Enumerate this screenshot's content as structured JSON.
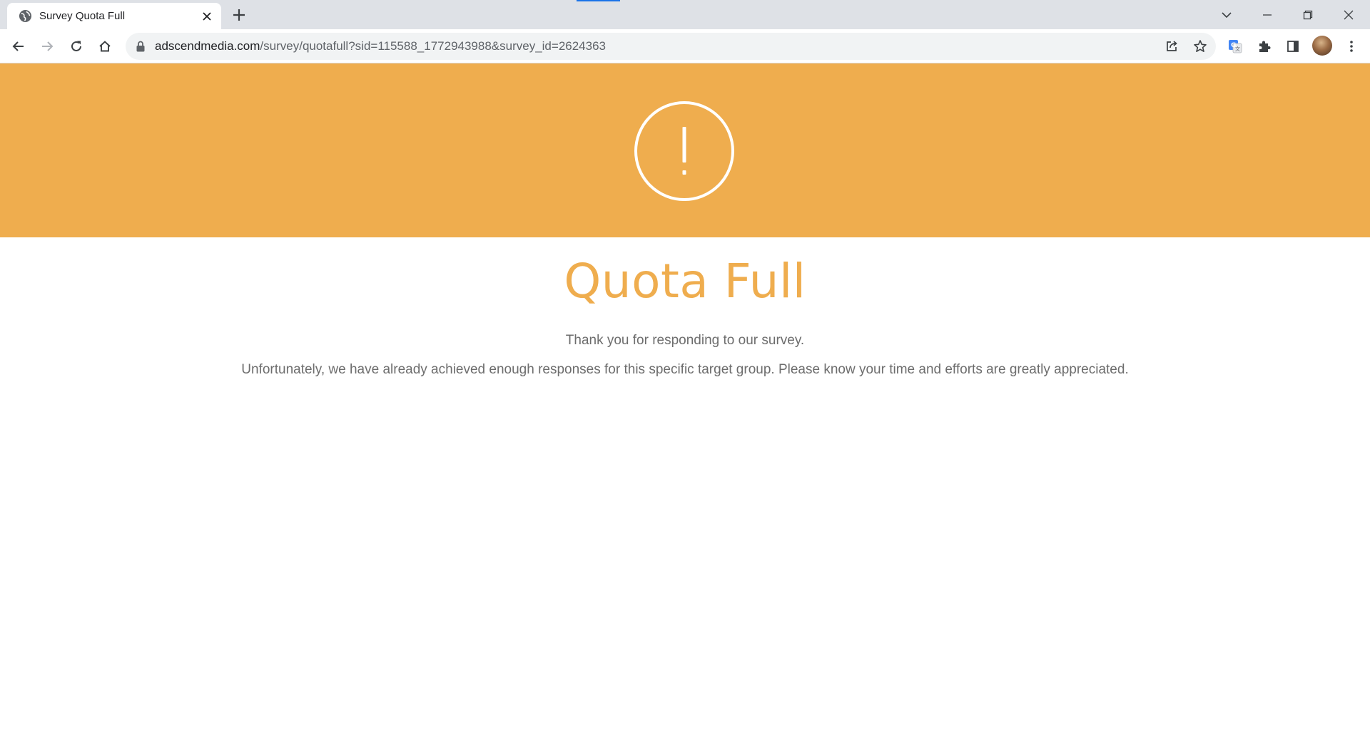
{
  "browser": {
    "tab": {
      "title": "Survey Quota Full"
    },
    "address_bar": {
      "host": "adscendmedia.com",
      "path": "/survey/quotafull?sid=115588_1772943988&survey_id=2624363"
    },
    "icons": {
      "favicon": "globe-icon",
      "close": "close-icon",
      "new_tab": "plus-icon",
      "back": "back-arrow-icon",
      "forward": "forward-arrow-icon",
      "reload": "reload-icon",
      "home": "home-icon",
      "lock": "lock-icon",
      "share": "share-icon",
      "bookmark": "star-icon",
      "translate": "google-translate-icon",
      "extensions": "puzzle-icon",
      "side_panel": "side-panel-icon",
      "menu": "kebab-menu-icon"
    }
  },
  "page": {
    "accent_color": "#efad4e",
    "icon": "exclamation-circle-icon",
    "heading": "Quota Full",
    "message_line_1": "Thank you for responding to our survey.",
    "message_line_2": "Unfortunately, we have already achieved enough responses for this specific target group. Please know your time and efforts are greatly appreciated."
  }
}
